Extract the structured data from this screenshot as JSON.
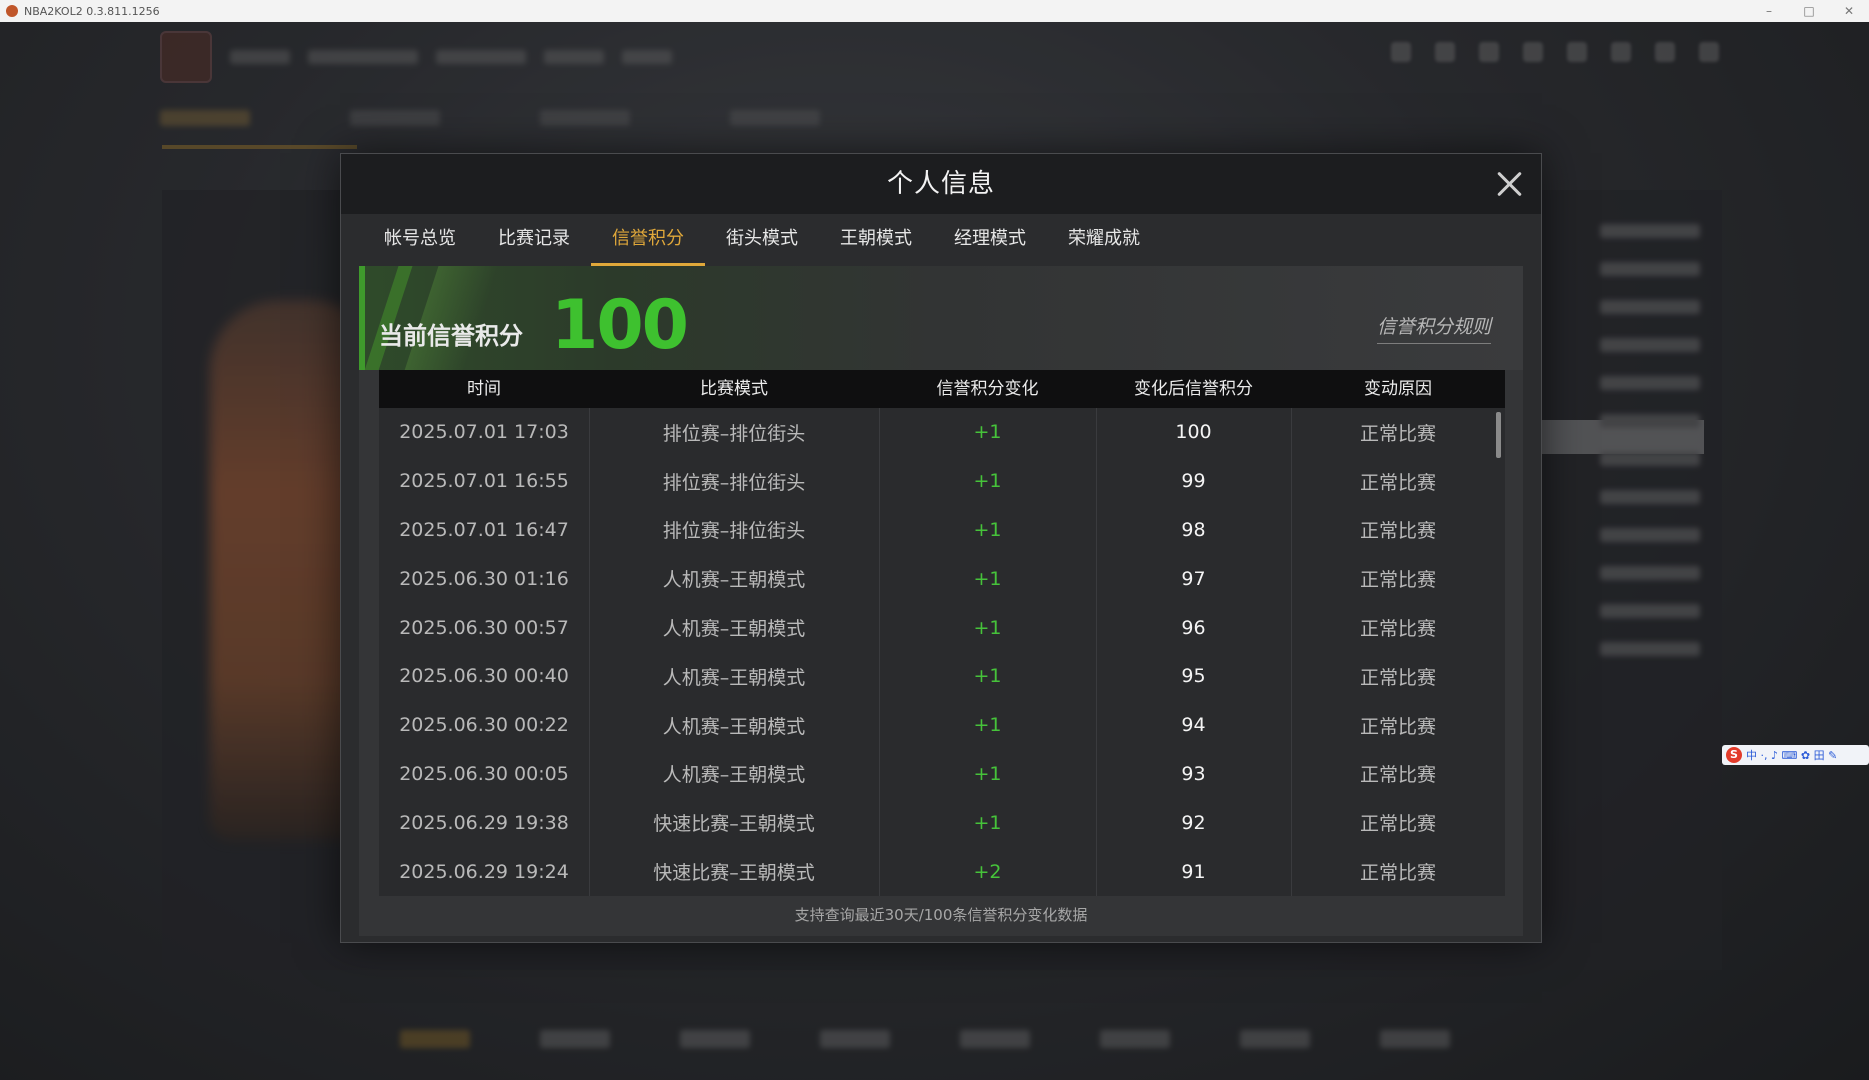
{
  "window": {
    "title": "NBA2KOL2 0.3.811.1256",
    "controls": [
      "–",
      "□",
      "✕"
    ]
  },
  "ime": {
    "logo": "S",
    "items": "中 ·, ♪ ⌨ ✿ 田 ✎"
  },
  "modal": {
    "title": "个人信息",
    "tabs": [
      {
        "label": "帐号总览",
        "active": false
      },
      {
        "label": "比赛记录",
        "active": false
      },
      {
        "label": "信誉积分",
        "active": true
      },
      {
        "label": "街头模式",
        "active": false
      },
      {
        "label": "王朝模式",
        "active": false
      },
      {
        "label": "经理模式",
        "active": false
      },
      {
        "label": "荣耀成就",
        "active": false
      }
    ],
    "score": {
      "label": "当前信誉积分",
      "value": "100",
      "rules_link": "信誉积分规则"
    },
    "table": {
      "headers": [
        "时间",
        "比赛模式",
        "信誉积分变化",
        "变化后信誉积分",
        "变动原因"
      ],
      "rows": [
        {
          "time": "2025.07.01  17:03",
          "mode": "排位赛–排位街头",
          "change": "+1",
          "after": "100",
          "reason": "正常比赛"
        },
        {
          "time": "2025.07.01  16:55",
          "mode": "排位赛–排位街头",
          "change": "+1",
          "after": "99",
          "reason": "正常比赛"
        },
        {
          "time": "2025.07.01  16:47",
          "mode": "排位赛–排位街头",
          "change": "+1",
          "after": "98",
          "reason": "正常比赛"
        },
        {
          "time": "2025.06.30  01:16",
          "mode": "人机赛–王朝模式",
          "change": "+1",
          "after": "97",
          "reason": "正常比赛"
        },
        {
          "time": "2025.06.30  00:57",
          "mode": "人机赛–王朝模式",
          "change": "+1",
          "after": "96",
          "reason": "正常比赛"
        },
        {
          "time": "2025.06.30  00:40",
          "mode": "人机赛–王朝模式",
          "change": "+1",
          "after": "95",
          "reason": "正常比赛"
        },
        {
          "time": "2025.06.30  00:22",
          "mode": "人机赛–王朝模式",
          "change": "+1",
          "after": "94",
          "reason": "正常比赛"
        },
        {
          "time": "2025.06.30  00:05",
          "mode": "人机赛–王朝模式",
          "change": "+1",
          "after": "93",
          "reason": "正常比赛"
        },
        {
          "time": "2025.06.29  19:38",
          "mode": "快速比赛–王朝模式",
          "change": "+1",
          "after": "92",
          "reason": "正常比赛"
        },
        {
          "time": "2025.06.29  19:24",
          "mode": "快速比赛–王朝模式",
          "change": "+2",
          "after": "91",
          "reason": "正常比赛"
        }
      ]
    },
    "footer_note": "支持查询最近30天/100条信誉积分变化数据"
  },
  "colors": {
    "accent_gold": "#e0a83a",
    "score_green": "#3ec12f",
    "change_green": "#46c33a"
  }
}
